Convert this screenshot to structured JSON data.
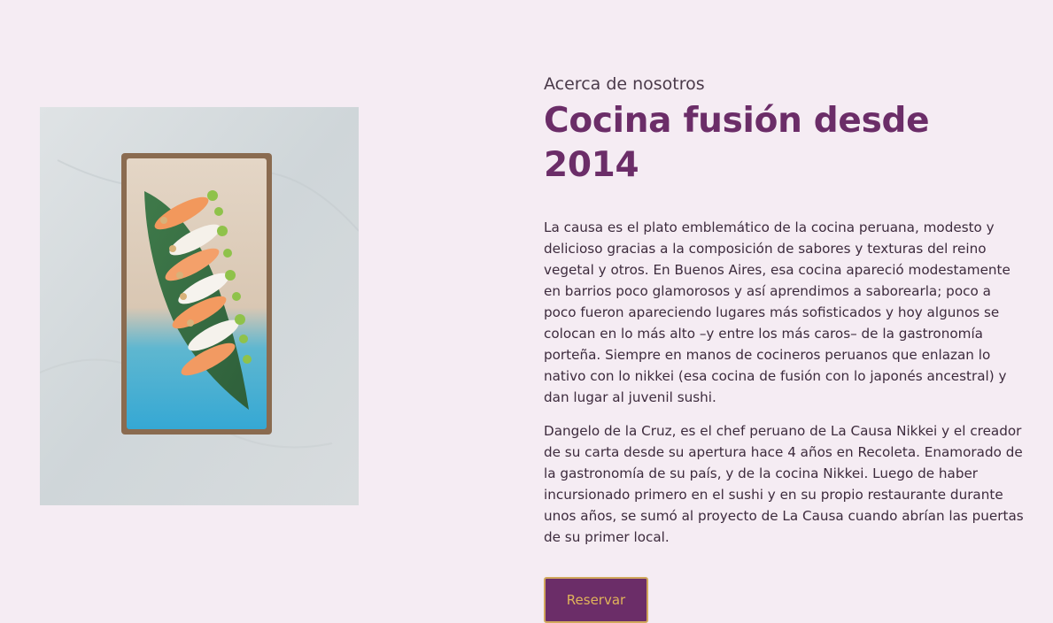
{
  "about": {
    "eyebrow": "Acerca de nosotros",
    "title": "Cocina fusión desde 2014",
    "paragraphs": [
      "La causa es el plato emblemático de la cocina peruana, modesto y delicioso gracias a la composición de sabores y texturas del reino vegetal y otros. En Buenos Aires, esa cocina apareció modestamente en barrios poco glamorosos y así aprendimos a saborearla; poco a poco fueron apareciendo lugares más sofisticados y hoy algunos se colocan en lo más alto –y entre los más caros– de la gastronomía porteña. Siempre en manos de cocineros peruanos que enlazan lo nativo con lo nikkei (esa cocina de fusión con lo japonés ancestral) y dan lugar al juvenil sushi.",
      "Dangelo de la Cruz, es el chef peruano de La Causa Nikkei y el creador de su carta desde su apertura hace 4 años en Recoleta. Enamorado de la gastronomía de su país, y de la cocina Nikkei. Luego de haber incursionado primero en el sushi y en su propio restaurante durante unos años, se sumó al proyecto de La Causa cuando abrían las puertas de su primer local."
    ],
    "reserve_label": "Reservar"
  },
  "image": {
    "subject": "sushi-plate-photo"
  },
  "colors": {
    "background": "#f5ecf3",
    "title": "#6b2d68",
    "button_bg": "#6b2d68",
    "button_text": "#e0b35a",
    "button_border": "#d1a85c"
  }
}
